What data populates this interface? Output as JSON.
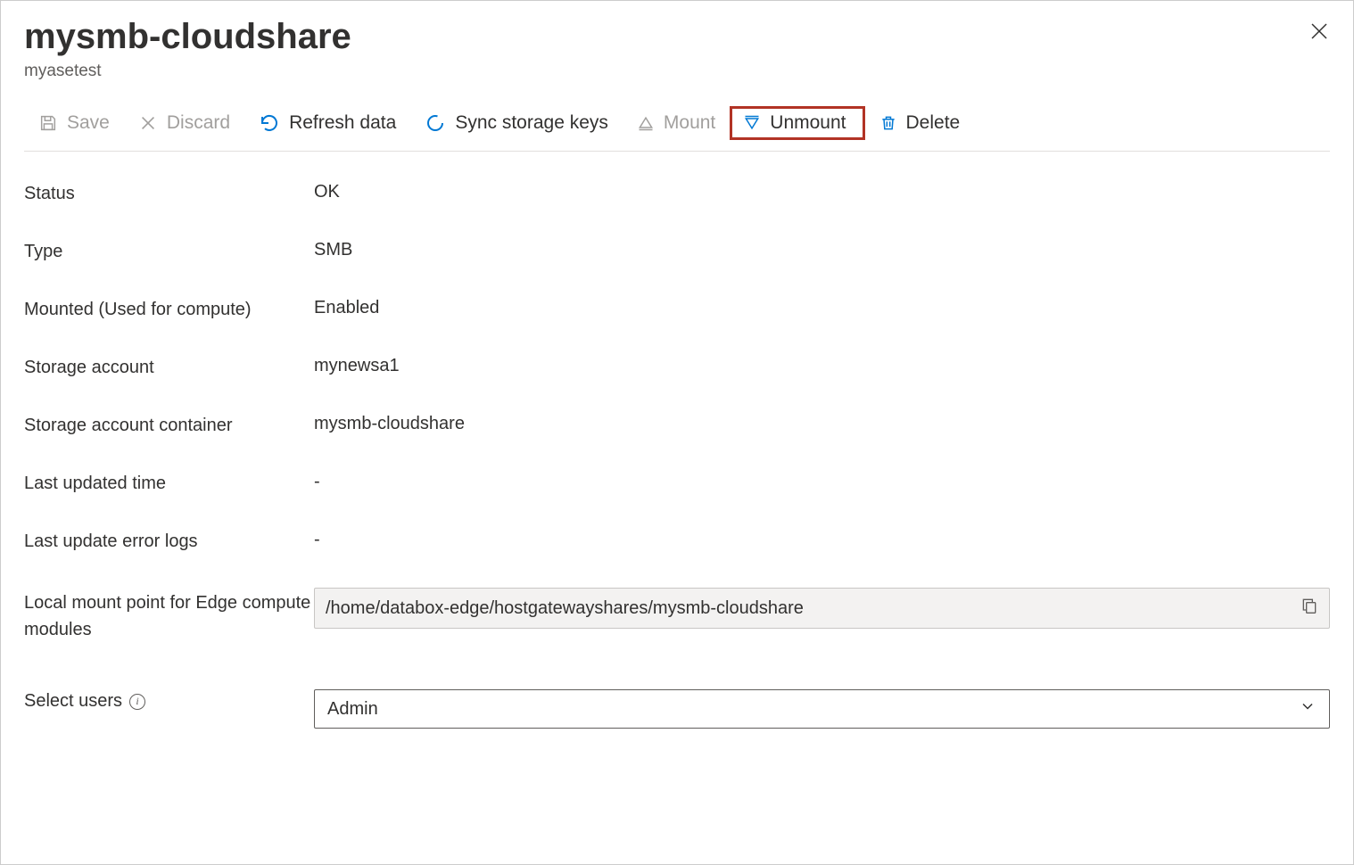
{
  "header": {
    "title": "mysmb-cloudshare",
    "subtitle": "myasetest"
  },
  "toolbar": {
    "save": "Save",
    "discard": "Discard",
    "refresh": "Refresh data",
    "sync": "Sync storage keys",
    "mount": "Mount",
    "unmount": "Unmount",
    "delete": "Delete"
  },
  "fields": {
    "status_label": "Status",
    "status_value": "OK",
    "type_label": "Type",
    "type_value": "SMB",
    "mounted_label": "Mounted (Used for compute)",
    "mounted_value": "Enabled",
    "storage_account_label": "Storage account",
    "storage_account_value": "mynewsa1",
    "container_label": "Storage account container",
    "container_value": "mysmb-cloudshare",
    "last_updated_label": "Last updated time",
    "last_updated_value": "-",
    "error_logs_label": "Last update error logs",
    "error_logs_value": "-",
    "mount_point_label": "Local mount point for Edge compute modules",
    "mount_point_value": "/home/databox-edge/hostgatewayshares/mysmb-cloudshare",
    "select_users_label": "Select users",
    "select_users_value": "Admin"
  }
}
